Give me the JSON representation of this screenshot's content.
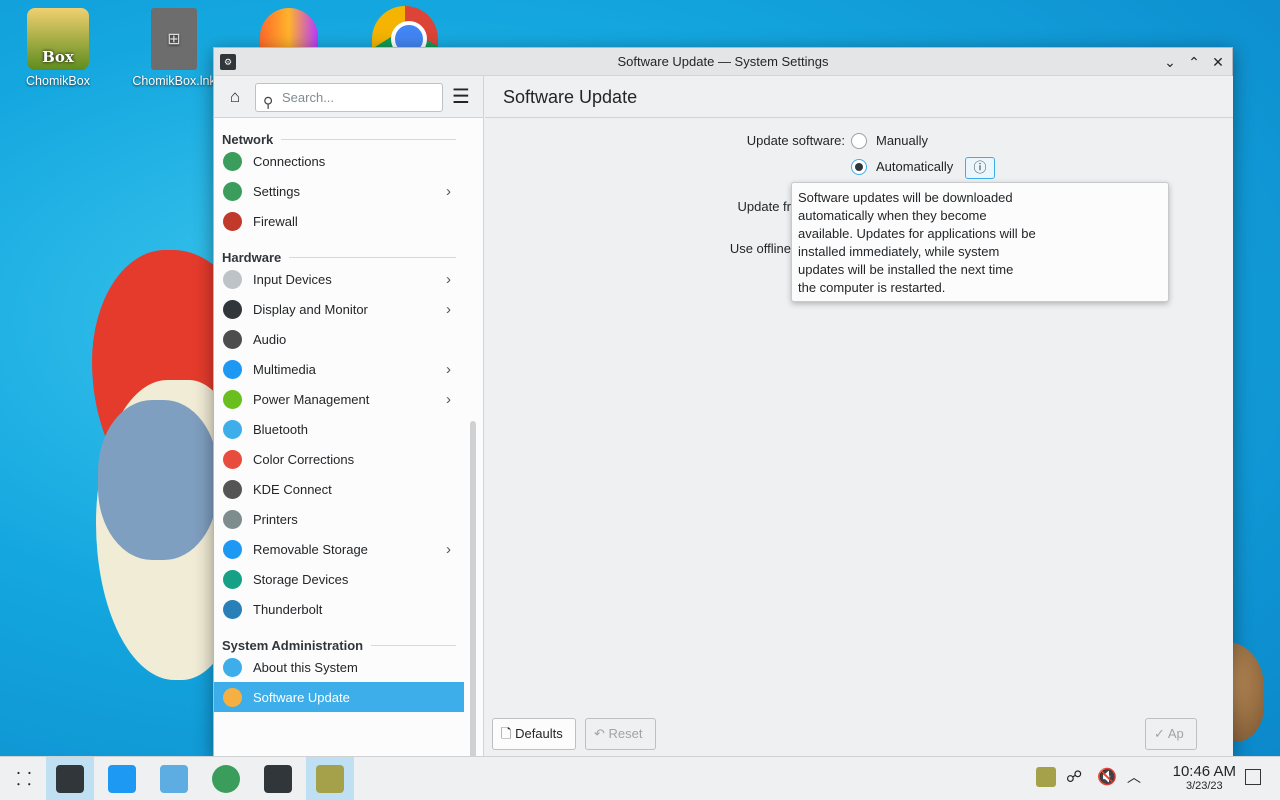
{
  "desktop": {
    "icons": [
      {
        "label": "ChomikBox"
      },
      {
        "label": "ChomikBox.lnk"
      }
    ],
    "chomik_badge": "Box"
  },
  "window": {
    "title": "Software Update — System Settings",
    "search_placeholder": "Search...",
    "sidebar": {
      "sections": [
        {
          "title": "Network",
          "items": [
            {
              "label": "Connections",
              "icon": "globe-icon",
              "color": "#3a9d5c"
            },
            {
              "label": "Settings",
              "icon": "globe-icon",
              "color": "#3a9d5c",
              "has_children": true
            },
            {
              "label": "Firewall",
              "icon": "firewall-icon",
              "color": "#c0392b"
            }
          ]
        },
        {
          "title": "Hardware",
          "items": [
            {
              "label": "Input Devices",
              "icon": "mouse-icon",
              "color": "#bdc3c7",
              "has_children": true
            },
            {
              "label": "Display and Monitor",
              "icon": "monitor-icon",
              "color": "#31363b",
              "has_children": true
            },
            {
              "label": "Audio",
              "icon": "speaker-icon",
              "color": "#4d4d4d"
            },
            {
              "label": "Multimedia",
              "icon": "multimedia-icon",
              "color": "#1d99f3",
              "has_children": true
            },
            {
              "label": "Power Management",
              "icon": "power-icon",
              "color": "#6abf1e",
              "has_children": true
            },
            {
              "label": "Bluetooth",
              "icon": "bluetooth-icon",
              "color": "#3daee9"
            },
            {
              "label": "Color Corrections",
              "icon": "color-wheel-icon",
              "color": "#e74c3c"
            },
            {
              "label": "KDE Connect",
              "icon": "phone-icon",
              "color": "#555555"
            },
            {
              "label": "Printers",
              "icon": "printer-icon",
              "color": "#7f8c8d"
            },
            {
              "label": "Removable Storage",
              "icon": "usb-drive-icon",
              "color": "#1d99f3",
              "has_children": true
            },
            {
              "label": "Storage Devices",
              "icon": "storage-icon",
              "color": "#16a085"
            },
            {
              "label": "Thunderbolt",
              "icon": "thunderbolt-icon",
              "color": "#2980b9"
            }
          ]
        },
        {
          "title": "System Administration",
          "items": [
            {
              "label": "About this System",
              "icon": "info-icon",
              "color": "#3daee9"
            },
            {
              "label": "Software Update",
              "icon": "update-icon",
              "color": "#f5b041",
              "selected": true
            }
          ]
        }
      ]
    },
    "page_title": "Software Update",
    "form": {
      "update_software_label": "Update software:",
      "option_manual": "Manually",
      "option_auto": "Automatically",
      "selected_option": "Automatically",
      "update_frequency_label_partial": "Update fr",
      "offline_label_partial": "Use offline",
      "help_icon": "help-icon"
    },
    "tooltip_lines": [
      "Software updates will be downloaded",
      "automatically when they become",
      "available. Updates for applications will be",
      "installed immediately, while system",
      "updates will be installed the next time",
      "the computer is restarted."
    ],
    "footer": {
      "defaults": "Defaults",
      "reset": "Reset",
      "apply_partial": "Ap"
    }
  },
  "taskbar": {
    "time": "10:46 AM",
    "date": "3/23/23"
  },
  "colors": {
    "accent": "#3daee9",
    "window_bg": "#eff0f1"
  }
}
